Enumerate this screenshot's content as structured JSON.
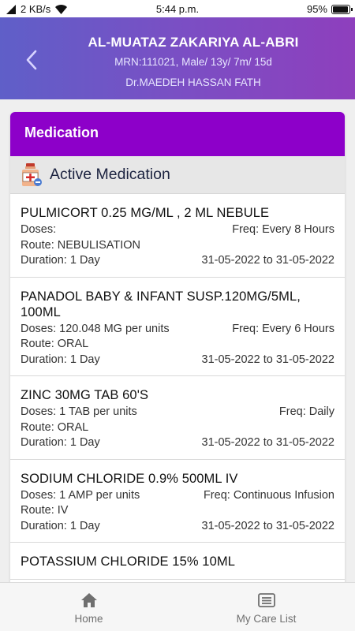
{
  "status_bar": {
    "network_speed": "2 KB/s",
    "time": "5:44 p.m.",
    "battery": "95%"
  },
  "header": {
    "patient_name": "AL-MUATAZ ZAKARIYA AL-ABRI",
    "patient_info": "MRN:111021, Male/ 13y/ 7m/ 15d",
    "doctor": "Dr.MAEDEH HASSAN FATH"
  },
  "card": {
    "title": "Medication",
    "section_title": "Active Medication"
  },
  "medications": [
    {
      "name": "PULMICORT 0.25 MG/ML , 2 ML NEBULE",
      "doses": "Doses:",
      "freq": "Freq: Every 8 Hours",
      "route": "Route: NEBULISATION",
      "duration": "Duration: 1 Day",
      "dates": "31-05-2022 to 31-05-2022"
    },
    {
      "name": "PANADOL BABY & INFANT SUSP.120MG/5ML, 100ML",
      "doses": "Doses: 120.048 MG per units",
      "freq": "Freq: Every 6 Hours",
      "route": "Route: ORAL",
      "duration": "Duration: 1 Day",
      "dates": "31-05-2022 to 31-05-2022"
    },
    {
      "name": "ZINC 30MG TAB 60'S",
      "doses": "Doses: 1 TAB per units",
      "freq": "Freq: Daily",
      "route": "Route: ORAL",
      "duration": "Duration: 1 Day",
      "dates": "31-05-2022 to 31-05-2022"
    },
    {
      "name": "SODIUM CHLORIDE 0.9% 500ML IV",
      "doses": "Doses: 1 AMP per units",
      "freq": "Freq: Continuous Infusion",
      "route": "Route: IV",
      "duration": "Duration: 1 Day",
      "dates": "31-05-2022 to 31-05-2022"
    },
    {
      "name": "POTASSIUM CHLORIDE 15% 10ML",
      "doses": "",
      "freq": "",
      "route": "",
      "duration": "",
      "dates": ""
    }
  ],
  "bottom_nav": {
    "home_label": "Home",
    "care_list_label": "My Care List"
  },
  "icons": {
    "back": "chevron-left-icon",
    "section": "medicine-bottle-icon",
    "home": "home-icon",
    "care_list": "list-icon"
  },
  "colors": {
    "header_gradient_start": "#5f5fc8",
    "header_gradient_end": "#8e3fbd",
    "card_header": "#8d00c9"
  }
}
